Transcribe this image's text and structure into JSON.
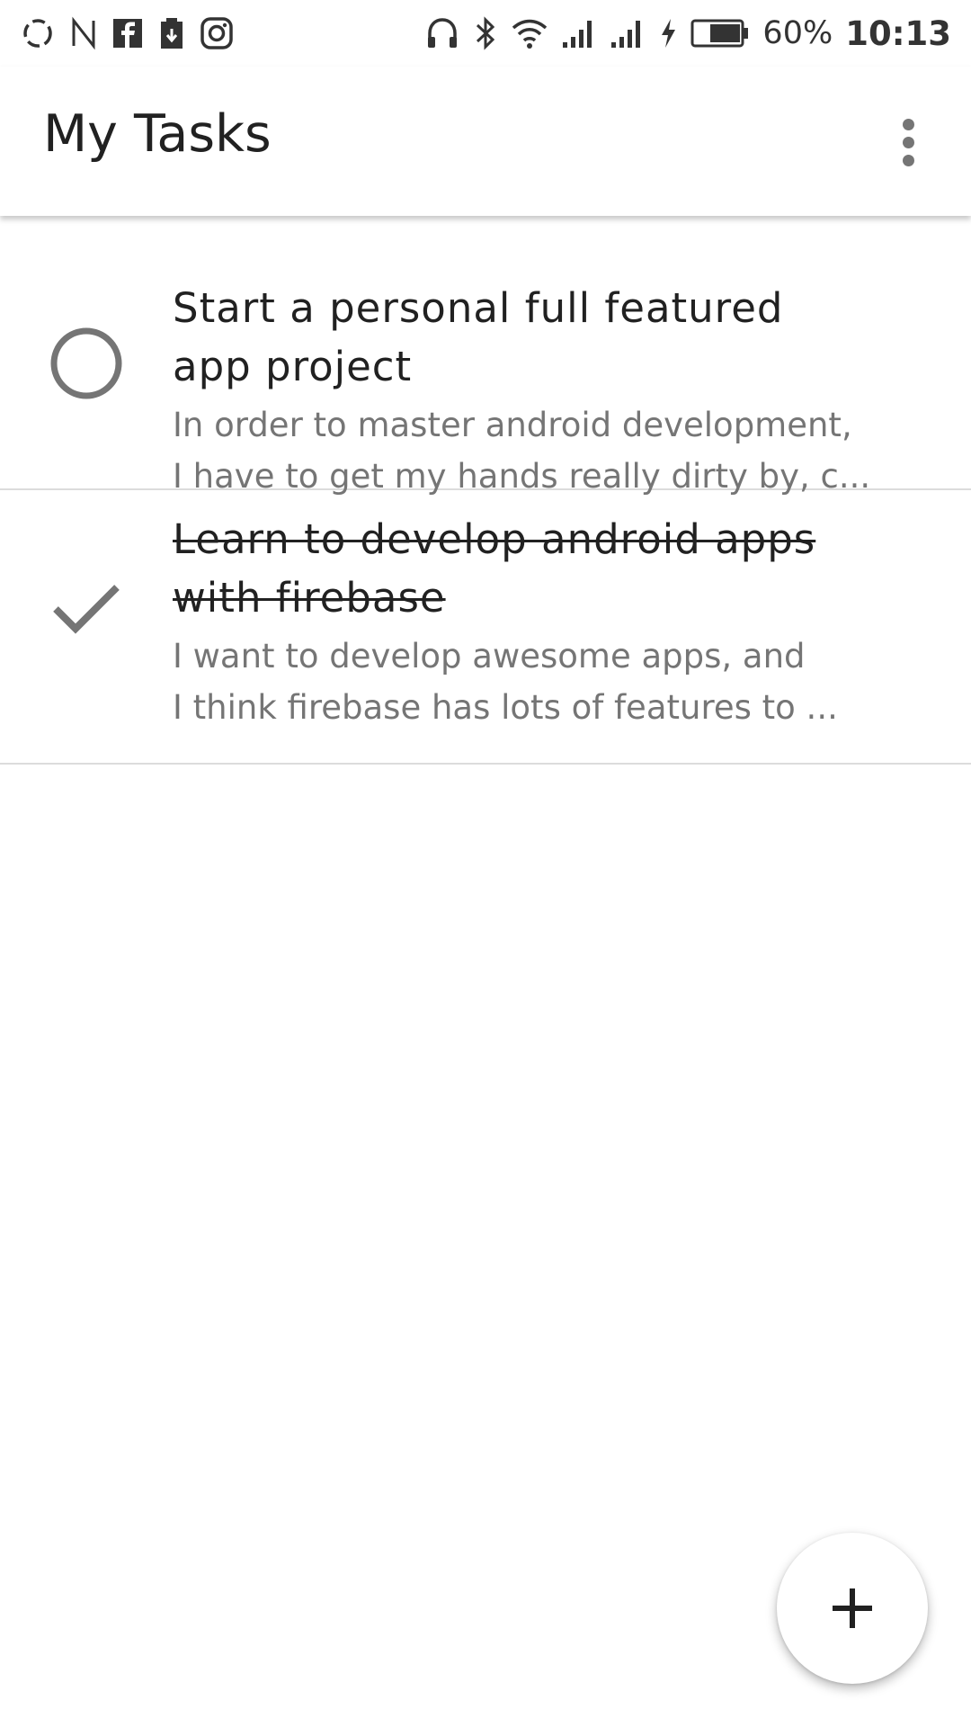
{
  "status_bar": {
    "left_icons": [
      "sync-icon",
      "n-icon",
      "facebook-icon",
      "download-icon",
      "instagram-icon"
    ],
    "right_icons": [
      "headphones-icon",
      "bluetooth-icon",
      "wifi-icon",
      "signal-icon",
      "signal-icon",
      "charging-icon",
      "battery-icon"
    ],
    "battery": "60%",
    "time": "10:13"
  },
  "app_bar": {
    "title": "My Tasks",
    "overflow_icon": "more-vert-icon"
  },
  "tasks": [
    {
      "title_line1": "Start a personal full featured",
      "title_line2": "app project",
      "desc_line1": "In order to master android development,",
      "desc_line2": "I have to get my hands really dirty by, c...",
      "done": false,
      "status_icon": "circle-unchecked-icon"
    },
    {
      "title_line1": "Learn to develop android apps",
      "title_line2": "with firebase",
      "desc_line1": "I want to develop awesome apps, and",
      "desc_line2": "I think firebase has lots of features to ...",
      "done": true,
      "status_icon": "checkmark-icon"
    }
  ],
  "fab": {
    "icon": "plus-icon"
  },
  "colors": {
    "text_primary": "#212121",
    "text_secondary": "#757575",
    "icon_grey": "#757575",
    "divider": "#dcdcdc",
    "background": "#ffffff"
  }
}
